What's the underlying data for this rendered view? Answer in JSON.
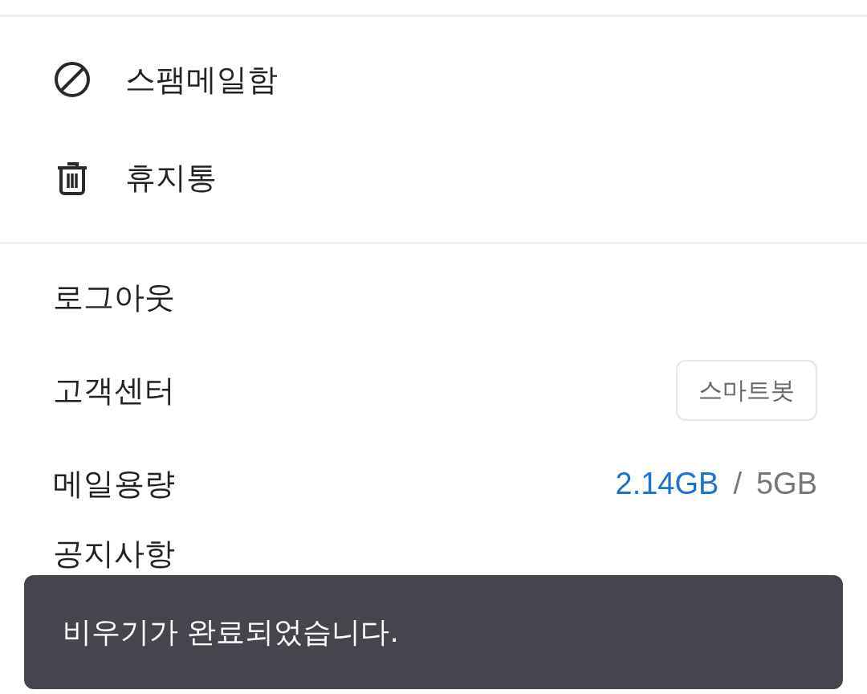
{
  "folders": [
    {
      "label": "스팸메일함",
      "kind": "spam"
    },
    {
      "label": "휴지통",
      "kind": "trash"
    }
  ],
  "settings": [
    {
      "label": "로그아웃",
      "kind": "plain"
    },
    {
      "label": "고객센터",
      "kind": "button",
      "button": "스마트봇"
    },
    {
      "label": "메일용량",
      "kind": "usage",
      "used": "2.14GB",
      "separator": "/",
      "total": "5GB"
    },
    {
      "label": "공지사항",
      "kind": "plain"
    }
  ],
  "toast": {
    "message": "비우기가 완료되었습니다."
  }
}
